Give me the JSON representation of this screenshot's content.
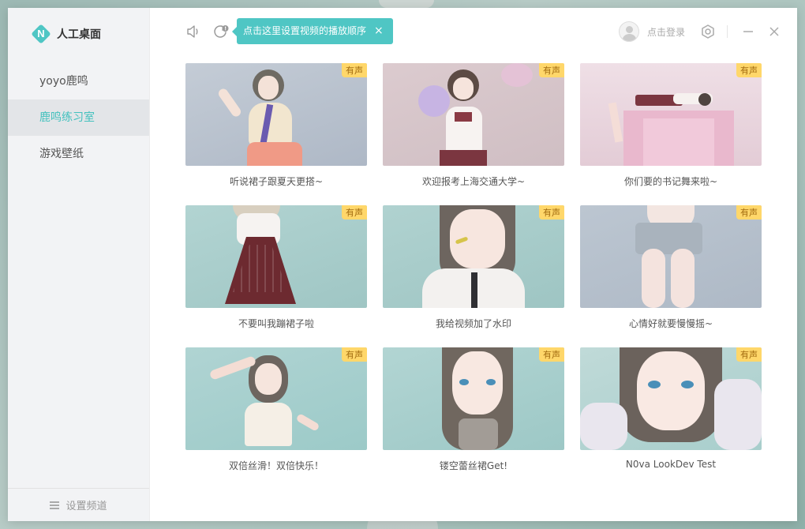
{
  "app": {
    "title": "人工桌面",
    "logo_letter": "N"
  },
  "sidebar": {
    "items": [
      {
        "label": "yoyo鹿鸣",
        "active": false
      },
      {
        "label": "鹿鸣练习室",
        "active": true
      },
      {
        "label": "游戏壁纸",
        "active": false
      }
    ],
    "footer_label": "设置频道"
  },
  "toolbar": {
    "tooltip_text": "点击这里设置视频的播放顺序",
    "tooltip_close": "×",
    "user_label": "点击登录",
    "minimize": "—",
    "close": "✕"
  },
  "icons": [
    "volume-icon",
    "playback-order-icon",
    "avatar",
    "settings-icon",
    "minimize-icon",
    "close-icon"
  ],
  "colors": {
    "accent": "#4fc6c4",
    "badge_bg": "#ffd76a",
    "badge_text": "#a26b10"
  },
  "videos": [
    {
      "title": "听说裙子跟夏天更搭~",
      "badge": "有声",
      "bg": "#b9c3cf"
    },
    {
      "title": "欢迎报考上海交通大学~",
      "badge": "有声",
      "bg": "#d9c8cc"
    },
    {
      "title": "你们要的书记舞来啦~",
      "badge": "有声",
      "bg": "#e8d6dd"
    },
    {
      "title": "不要叫我蹦裙子啦",
      "badge": "有声",
      "bg": "#a9cccc"
    },
    {
      "title": "我给视频加了水印",
      "badge": "有声",
      "bg": "#a7cbc9"
    },
    {
      "title": "心情好就要慢慢摇~",
      "badge": "有声",
      "bg": "#b6bfca"
    },
    {
      "title": "双倍丝滑！双倍快乐！",
      "badge": "有声",
      "bg": "#a6cfcd"
    },
    {
      "title": "镂空蕾丝裙Get!",
      "badge": "有声",
      "bg": "#a8cdcb"
    },
    {
      "title": "N0va LookDev Test",
      "badge": "有声",
      "bg": "#b5d3d1"
    }
  ]
}
